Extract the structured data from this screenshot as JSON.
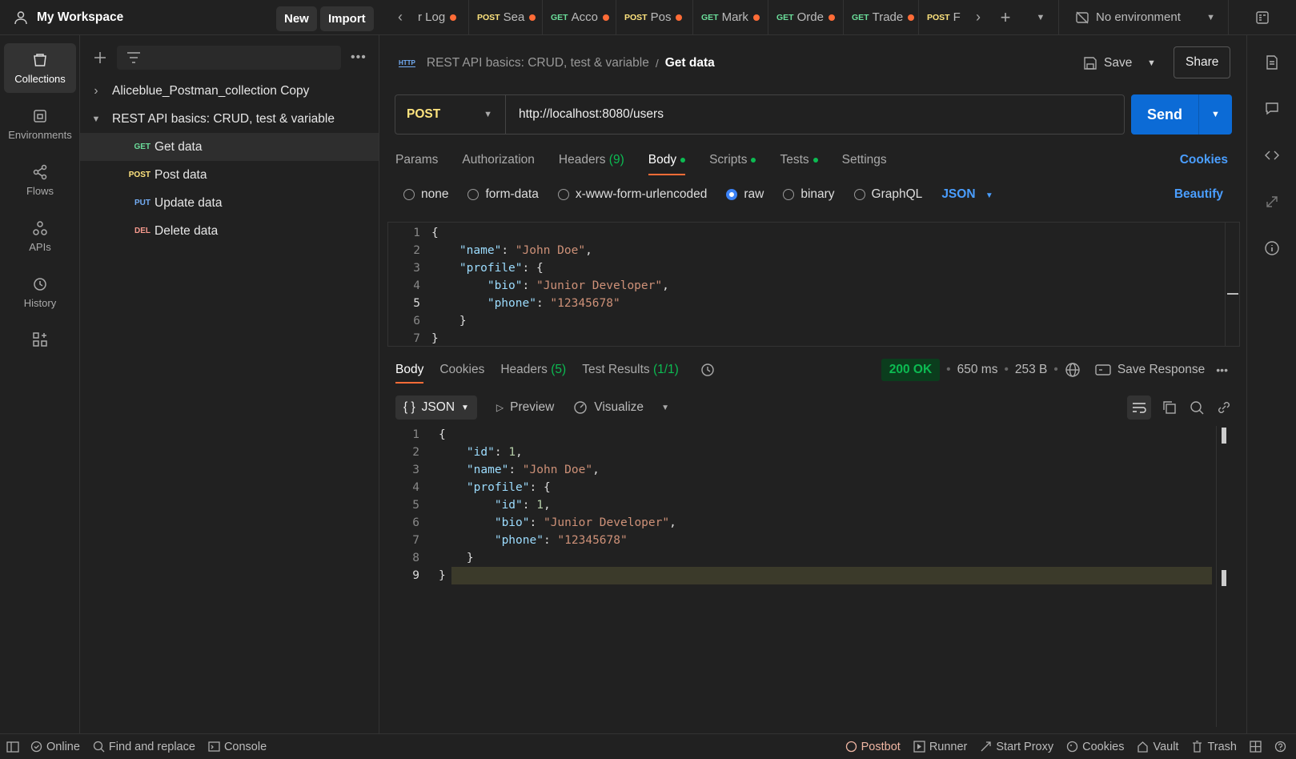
{
  "workspace": {
    "name": "My Workspace",
    "new_label": "New",
    "import_label": "Import"
  },
  "rail": [
    {
      "label": "Collections",
      "icon": "trash-can-icon"
    },
    {
      "label": "Environments",
      "icon": "environment-icon"
    },
    {
      "label": "Flows",
      "icon": "flows-icon"
    },
    {
      "label": "APIs",
      "icon": "apis-icon"
    },
    {
      "label": "History",
      "icon": "history-icon"
    }
  ],
  "tree": {
    "collections": [
      "Aliceblue_Postman_collection Copy",
      "REST API basics: CRUD, test & variable"
    ],
    "requests": [
      {
        "method": "GET",
        "name": "Get data"
      },
      {
        "method": "POST",
        "name": "Post data"
      },
      {
        "method": "PUT",
        "name": "Update data"
      },
      {
        "method": "DEL",
        "name": "Delete data"
      }
    ]
  },
  "tabs": [
    {
      "method": "",
      "label": "r Log"
    },
    {
      "method": "POST",
      "label": "Sea"
    },
    {
      "method": "GET",
      "label": "Acco"
    },
    {
      "method": "POST",
      "label": "Pos"
    },
    {
      "method": "GET",
      "label": "Mark"
    },
    {
      "method": "GET",
      "label": "Orde"
    },
    {
      "method": "GET",
      "label": "Trade"
    },
    {
      "method": "POST",
      "label": "F"
    }
  ],
  "environment": "No environment",
  "breadcrumb": {
    "parent": "REST API basics: CRUD, test & variable",
    "sep": "/",
    "current": "Get data",
    "badge": "HTTP"
  },
  "save_label": "Save",
  "share_label": "Share",
  "request": {
    "method": "POST",
    "url": "http://localhost:8080/users",
    "send_label": "Send"
  },
  "req_tabs": {
    "params": "Params",
    "auth": "Authorization",
    "headers": "Headers",
    "headers_count": "(9)",
    "body": "Body",
    "scripts": "Scripts",
    "tests": "Tests",
    "settings": "Settings",
    "cookies": "Cookies"
  },
  "body_types": {
    "none": "none",
    "form": "form-data",
    "urlenc": "x-www-form-urlencoded",
    "raw": "raw",
    "binary": "binary",
    "graphql": "GraphQL",
    "lang": "JSON",
    "beautify": "Beautify"
  },
  "req_lines": [
    "1",
    "2",
    "3",
    "4",
    "5",
    "6",
    "7"
  ],
  "req_code": {
    "name_k": "\"name\"",
    "name_v": "\"John Doe\"",
    "profile_k": "\"profile\"",
    "bio_k": "\"bio\"",
    "bio_v": "\"Junior Developer\"",
    "phone_k": "\"phone\"",
    "phone_v": "\"12345678\""
  },
  "resp_tabs": {
    "body": "Body",
    "cookies": "Cookies",
    "headers": "Headers",
    "headers_count": "(5)",
    "tests": "Test Results",
    "tests_count": "(1/1)"
  },
  "resp_meta": {
    "status": "200 OK",
    "time": "650 ms",
    "size": "253 B",
    "save": "Save Response"
  },
  "resp_view": {
    "format": "JSON",
    "preview": "Preview",
    "visualize": "Visualize"
  },
  "resp_lines": [
    "1",
    "2",
    "3",
    "4",
    "5",
    "6",
    "7",
    "8",
    "9"
  ],
  "resp_code": {
    "id_k": "\"id\"",
    "id_v": "1",
    "name_k": "\"name\"",
    "name_v": "\"John Doe\"",
    "profile_k": "\"profile\"",
    "bio_k": "\"bio\"",
    "bio_v": "\"Junior Developer\"",
    "phone_k": "\"phone\"",
    "phone_v": "\"12345678\""
  },
  "status_bar": {
    "online": "Online",
    "find": "Find and replace",
    "console": "Console",
    "postbot": "Postbot",
    "runner": "Runner",
    "proxy": "Start Proxy",
    "cookies": "Cookies",
    "vault": "Vault",
    "trash": "Trash"
  },
  "colors": {
    "accent": "#ff6c37",
    "send": "#0c6bd6",
    "link": "#4a9eff",
    "ok": "#0cbb52"
  }
}
